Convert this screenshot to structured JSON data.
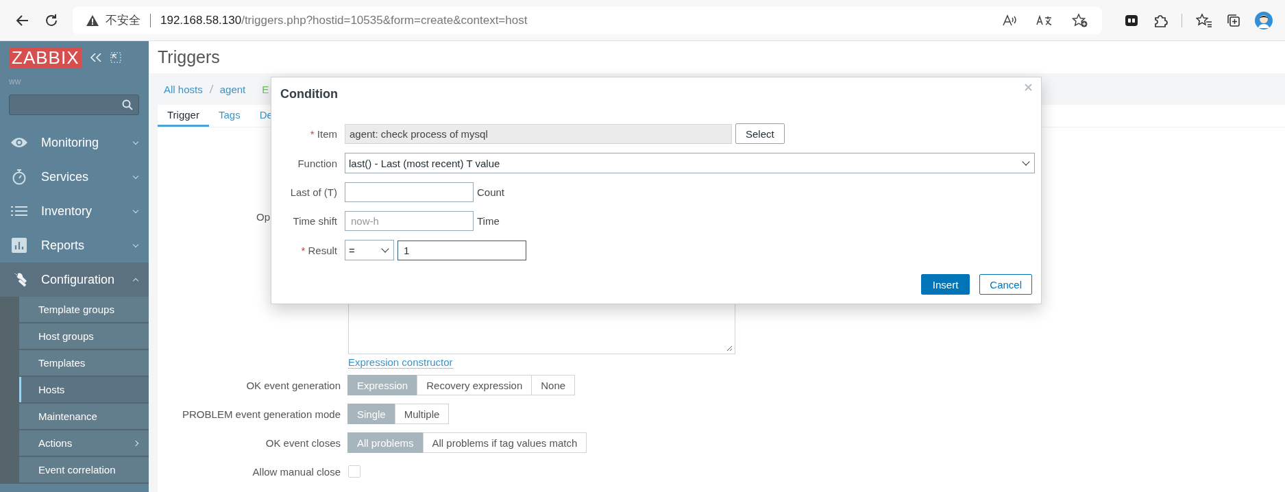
{
  "browser": {
    "security": "不安全",
    "url_host": "192.168.58.130",
    "url_path": "/triggers.php?hostid=10535&form=create&context=host"
  },
  "sidebar": {
    "logo": "ZABBIX",
    "user": "ww",
    "menu": [
      {
        "label": "Monitoring",
        "kind": "eye",
        "expanded": false
      },
      {
        "label": "Services",
        "kind": "timer",
        "expanded": false
      },
      {
        "label": "Inventory",
        "kind": "list",
        "expanded": false
      },
      {
        "label": "Reports",
        "kind": "chart",
        "expanded": false
      },
      {
        "label": "Configuration",
        "kind": "wrench",
        "expanded": true,
        "children": [
          {
            "label": "Template groups",
            "selected": false,
            "has_submenu": false
          },
          {
            "label": "Host groups",
            "selected": false,
            "has_submenu": false
          },
          {
            "label": "Templates",
            "selected": false,
            "has_submenu": false
          },
          {
            "label": "Hosts",
            "selected": true,
            "has_submenu": false
          },
          {
            "label": "Maintenance",
            "selected": false,
            "has_submenu": false
          },
          {
            "label": "Actions",
            "selected": false,
            "has_submenu": true
          },
          {
            "label": "Event correlation",
            "selected": false,
            "has_submenu": false
          }
        ]
      }
    ]
  },
  "page": {
    "title": "Triggers",
    "breadcrumbs": [
      {
        "label": "All hosts",
        "kind": "link"
      },
      {
        "label": "agent",
        "kind": "link"
      },
      {
        "label": "E",
        "kind": "status"
      }
    ],
    "tabs": [
      {
        "label": "Trigger",
        "selected": true
      },
      {
        "label": "Tags",
        "selected": false
      },
      {
        "label": "De",
        "selected": false
      }
    ],
    "hidden_label": "Op",
    "expression_link": "Expression constructor",
    "rows": [
      {
        "label": "OK event generation",
        "kind": "segmented",
        "options": [
          {
            "label": "Expression",
            "selected": true
          },
          {
            "label": "Recovery expression",
            "selected": false
          },
          {
            "label": "None",
            "selected": false
          }
        ]
      },
      {
        "label": "PROBLEM event generation mode",
        "kind": "segmented",
        "options": [
          {
            "label": "Single",
            "selected": true
          },
          {
            "label": "Multiple",
            "selected": false
          }
        ]
      },
      {
        "label": "OK event closes",
        "kind": "segmented",
        "options": [
          {
            "label": "All problems",
            "selected": true
          },
          {
            "label": "All problems if tag values match",
            "selected": false
          }
        ]
      },
      {
        "label": "Allow manual close",
        "kind": "checkbox",
        "checked": false
      }
    ]
  },
  "dialog": {
    "title": "Condition",
    "required_marker": "*",
    "item": {
      "label": "Item",
      "required": true,
      "value": "agent: check process of mysql",
      "button": "Select"
    },
    "function": {
      "label": "Function",
      "required": false,
      "value": "last() - Last (most recent) T value"
    },
    "last_of": {
      "label": "Last of (T)",
      "required": false,
      "suffix": "Count"
    },
    "time_shift": {
      "label": "Time shift",
      "required": false,
      "placeholder": "now-h",
      "suffix": "Time"
    },
    "result": {
      "label": "Result",
      "required": true,
      "operator": "=",
      "value": "1"
    },
    "buttons": {
      "primary": "Insert",
      "secondary": "Cancel"
    }
  }
}
